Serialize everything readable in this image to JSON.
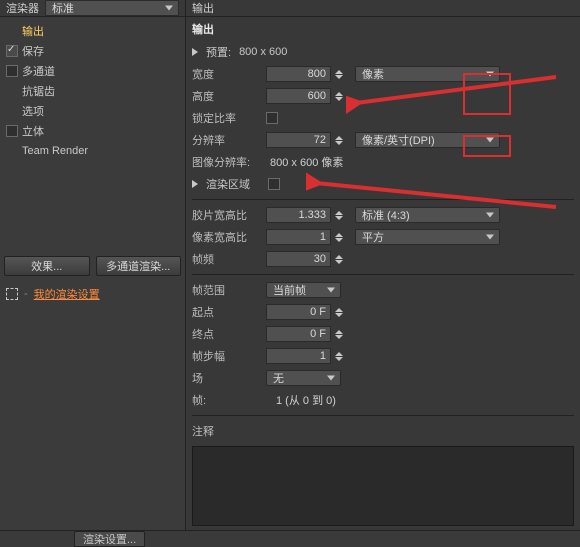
{
  "top": {
    "renderer_label": "渲染器",
    "renderer_value": "标准",
    "output_label": "输出"
  },
  "sidebar": {
    "items": [
      {
        "label": "输出",
        "active": true,
        "cb": "none"
      },
      {
        "label": "保存",
        "cb": "checked"
      },
      {
        "label": "多通道",
        "cb": "empty"
      },
      {
        "label": "抗锯齿",
        "cb": "none"
      },
      {
        "label": "选项",
        "cb": "none"
      },
      {
        "label": "立体",
        "cb": "empty"
      },
      {
        "label": "Team Render",
        "cb": "none"
      }
    ],
    "effect_btn": "效果...",
    "multi_btn": "多通道渲染...",
    "my_settings": "我的渲染设置"
  },
  "panel": {
    "preset_lbl": "预置:",
    "preset_val": "800 x 600",
    "width_lbl": "宽度",
    "width_val": "800",
    "height_lbl": "高度",
    "height_val": "600",
    "unit_pixels": "像素",
    "lock_lbl": "锁定比率",
    "res_lbl": "分辨率",
    "res_val": "72",
    "res_unit": "像素/英寸(DPI)",
    "img_res_lbl": "图像分辨率:",
    "img_res_val": "800 x 600 像素",
    "render_region_lbl": "渲染区域",
    "film_lbl": "胶片宽高比",
    "film_val": "1.333",
    "film_unit": "标准 (4:3)",
    "pixel_lbl": "像素宽高比",
    "pixel_val": "1",
    "pixel_unit": "平方",
    "fps_lbl": "帧频",
    "fps_val": "30",
    "range_lbl": "帧范围",
    "range_val": "当前帧",
    "start_lbl": "起点",
    "start_val": "0 F",
    "end_lbl": "终点",
    "end_val": "0 F",
    "step_lbl": "帧步幅",
    "step_val": "1",
    "field_lbl": "场",
    "field_val": "无",
    "frames_lbl": "帧:",
    "frames_val": "1 (从 0 到 0)",
    "notes_lbl": "注释"
  },
  "bottom": {
    "tab": "渲染设置..."
  }
}
